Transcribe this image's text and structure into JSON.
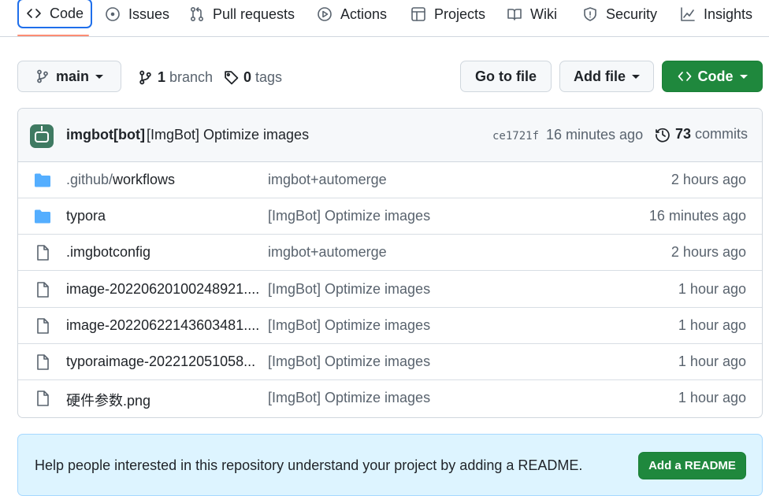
{
  "nav": {
    "tabs": [
      {
        "label": "Code",
        "icon": "code-icon",
        "selected": true
      },
      {
        "label": "Issues",
        "icon": "issue-icon"
      },
      {
        "label": "Pull requests",
        "icon": "pull-request-icon"
      },
      {
        "label": "Actions",
        "icon": "play-icon"
      },
      {
        "label": "Projects",
        "icon": "table-icon"
      },
      {
        "label": "Wiki",
        "icon": "book-icon"
      },
      {
        "label": "Security",
        "icon": "shield-icon"
      },
      {
        "label": "Insights",
        "icon": "graph-icon"
      }
    ]
  },
  "toolbar": {
    "branch_selector": "main",
    "branch_count": "1",
    "branch_label": "branch",
    "tag_count": "0",
    "tag_label": "tags",
    "go_to_file": "Go to file",
    "add_file": "Add file",
    "code": "Code"
  },
  "commit": {
    "author": "imgbot[bot]",
    "message": "[ImgBot] Optimize images",
    "sha": "ce1721f",
    "age": "16 minutes ago",
    "count": "73",
    "count_label": "commits"
  },
  "files": [
    {
      "type": "folder",
      "name_prefix": ".github/",
      "name": "workflows",
      "message": "imgbot+automerge",
      "age": "2 hours ago"
    },
    {
      "type": "folder",
      "name_prefix": "",
      "name": "typora",
      "message": "[ImgBot] Optimize images",
      "age": "16 minutes ago"
    },
    {
      "type": "file",
      "name_prefix": "",
      "name": ".imgbotconfig",
      "message": "imgbot+automerge",
      "age": "2 hours ago"
    },
    {
      "type": "file",
      "name_prefix": "",
      "name": "image-20220620100248921....",
      "message": "[ImgBot] Optimize images",
      "age": "1 hour ago"
    },
    {
      "type": "file",
      "name_prefix": "",
      "name": "image-20220622143603481....",
      "message": "[ImgBot] Optimize images",
      "age": "1 hour ago"
    },
    {
      "type": "file",
      "name_prefix": "",
      "name": "typoraimage-202212051058...",
      "message": "[ImgBot] Optimize images",
      "age": "1 hour ago"
    },
    {
      "type": "file",
      "name_prefix": "",
      "name": "硬件参数.png",
      "message": "[ImgBot] Optimize images",
      "age": "1 hour ago"
    }
  ],
  "readme": {
    "text": "Help people interested in this repository understand your project by adding a README.",
    "button": "Add a README"
  },
  "colors": {
    "accent_blue": "#1f6feb",
    "tab_underline": "#fd8c73",
    "primary_green": "#1f883d",
    "folder_blue": "#54aeff",
    "readme_bg": "#ddf4ff"
  }
}
